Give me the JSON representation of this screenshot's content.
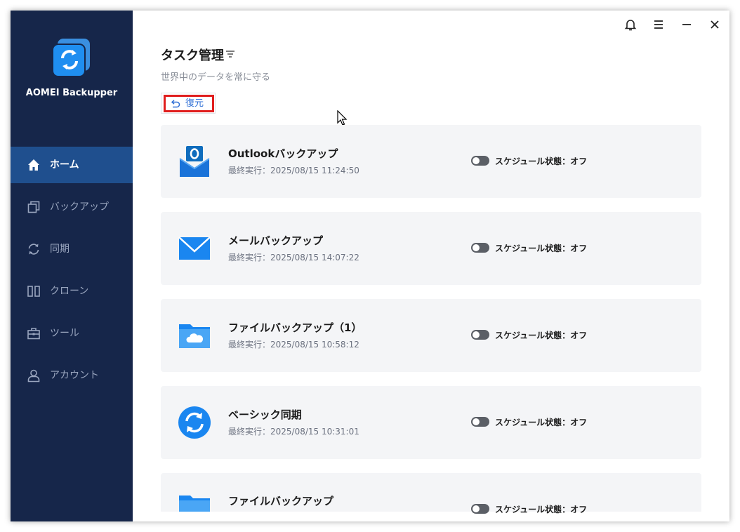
{
  "app": {
    "name": "AOMEI Backupper"
  },
  "sidebar": {
    "items": [
      {
        "label": "ホーム",
        "icon": "home-icon",
        "active": true
      },
      {
        "label": "バックアップ",
        "icon": "backup-icon"
      },
      {
        "label": "同期",
        "icon": "sync-icon"
      },
      {
        "label": "クローン",
        "icon": "clone-icon"
      },
      {
        "label": "ツール",
        "icon": "tools-icon"
      },
      {
        "label": "アカウント",
        "icon": "account-icon"
      }
    ]
  },
  "header": {
    "title": "タスク管理",
    "subtitle": "世界中のデータを常に守る",
    "restore_label": "復元"
  },
  "tasks": [
    {
      "title": "Outlookバックアップ",
      "last_run": "最終実行：2025/08/15 11:24:50",
      "schedule": "スケジュール状態：オフ",
      "icon": "outlook-icon"
    },
    {
      "title": "メールバックアップ",
      "last_run": "最終実行：2025/08/15 14:07:22",
      "schedule": "スケジュール状態：オフ",
      "icon": "mail-icon"
    },
    {
      "title": "ファイルバックアップ（1）",
      "last_run": "最終実行：2025/08/15 10:58:12",
      "schedule": "スケジュール状態：オフ",
      "icon": "cloud-folder-icon"
    },
    {
      "title": "ベーシック同期",
      "last_run": "最終実行：2025/08/15 10:31:01",
      "schedule": "スケジュール状態：オフ",
      "icon": "sync-circle-icon"
    },
    {
      "title": "ファイルバックアップ",
      "last_run": "",
      "schedule": "スケジュール状態：オフ",
      "icon": "folder-icon"
    }
  ],
  "colors": {
    "sidebar": "#16264a",
    "sidebar_active": "#1f4f8e",
    "accent": "#2f6fd6",
    "highlight": "#e01e1e"
  }
}
